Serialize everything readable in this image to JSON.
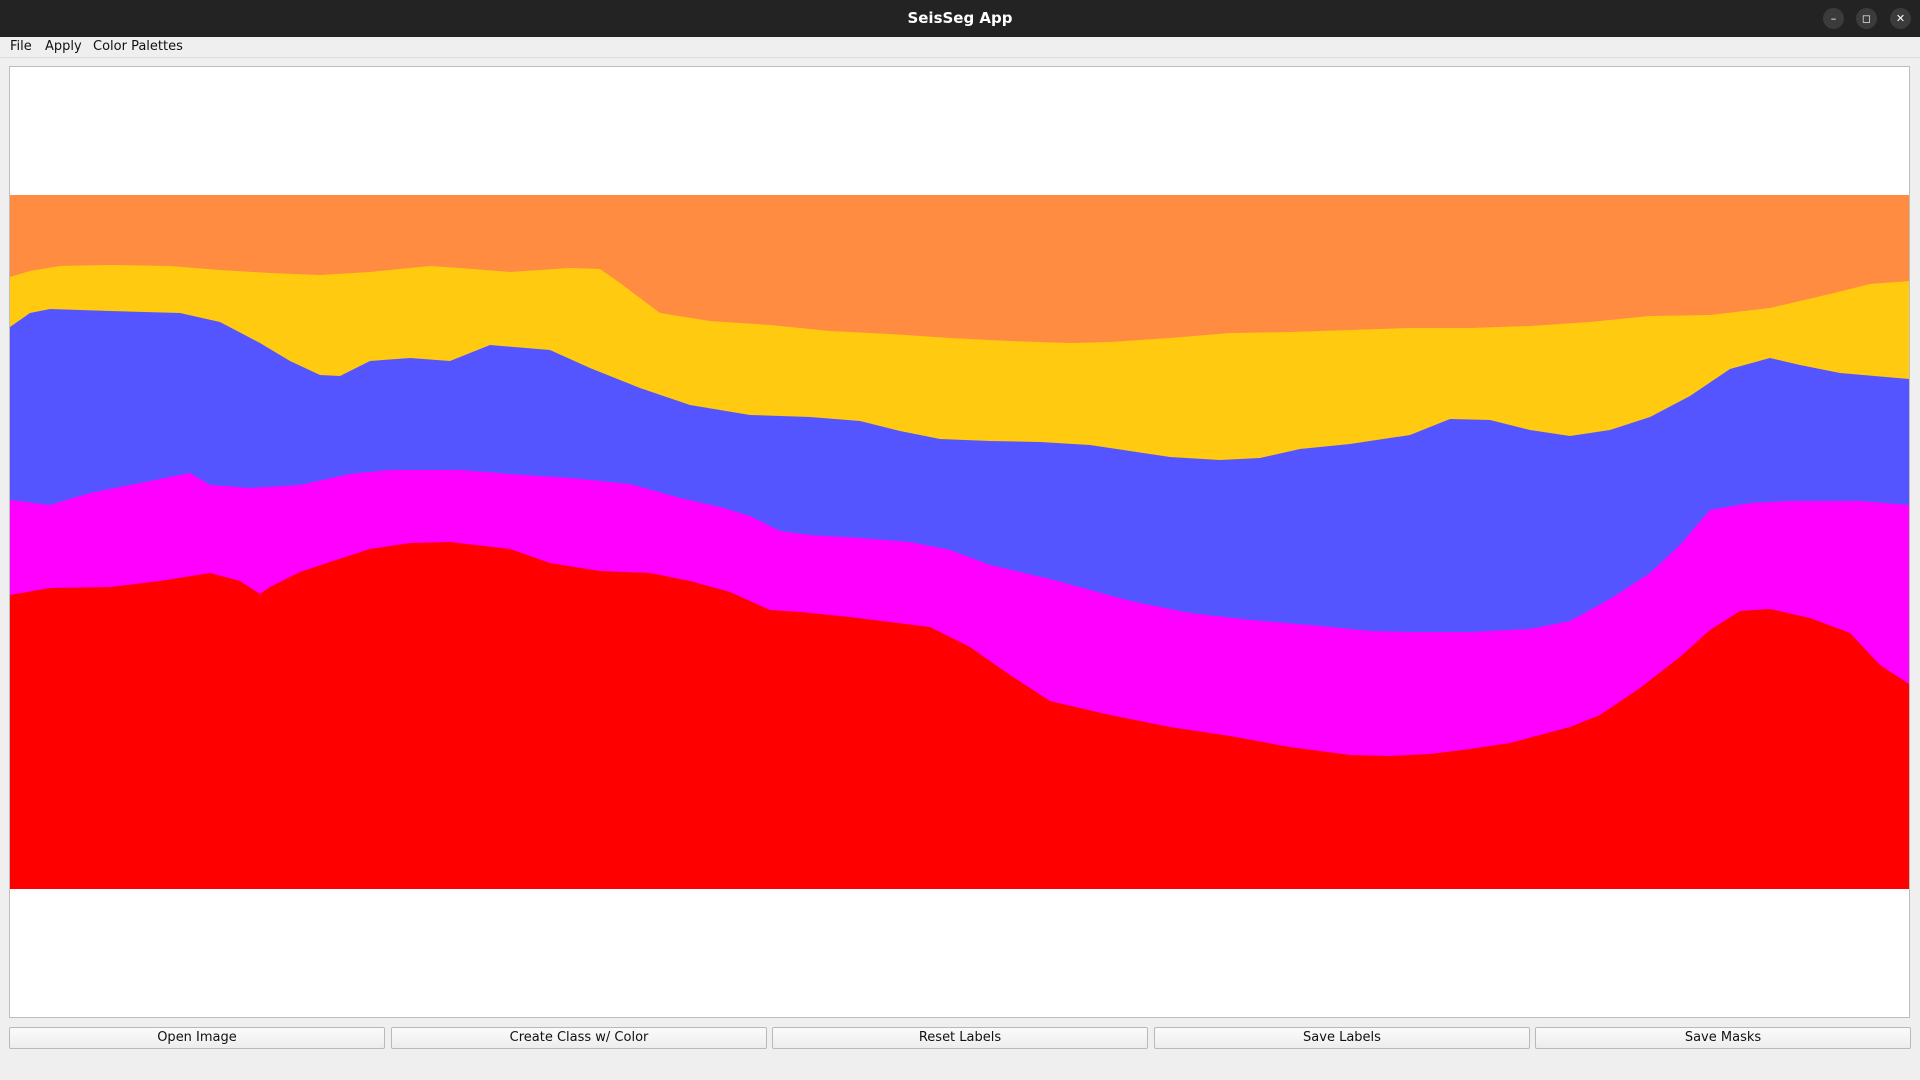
{
  "window": {
    "title": "SeisSeg App",
    "minimize_glyph": "–",
    "maximize_glyph": "◻",
    "close_glyph": "✕"
  },
  "menu": {
    "file": "File",
    "apply": "Apply",
    "color_palettes": "Color Palettes"
  },
  "segmentation": {
    "layer_colors": [
      "#ff8c41",
      "#ffca0f",
      "#5555ff",
      "#ff00ff",
      "#ff0000"
    ]
  },
  "buttons": {
    "open_image": "Open Image",
    "create_class": "Create Class w/ Color",
    "reset_labels": "Reset Labels",
    "save_labels": "Save Labels",
    "save_masks": "Save Masks"
  }
}
